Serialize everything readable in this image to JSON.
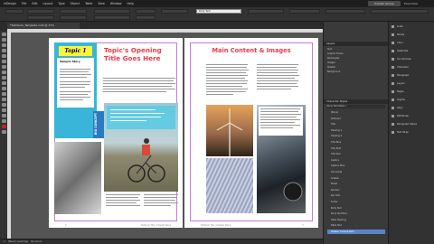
{
  "menu": {
    "app": "InDesign",
    "items": [
      "File",
      "Edit",
      "Layout",
      "Type",
      "Object",
      "Table",
      "View",
      "Window",
      "Help"
    ],
    "publish_label": "Publish Online",
    "workspace_label": "Essentials"
  },
  "control": {
    "paragraph_style": "Body Text"
  },
  "document": {
    "tab_label": "*Textbook_Template.indd @ 37%"
  },
  "left_page": {
    "topic_label": "Topic 1",
    "sidebar_heading": "Sample Story",
    "title": "Topic's Opening Title Goes Here",
    "vertical_label": "BIG CONCEPT",
    "footer": "Textbook Title | Chapter Name",
    "page_number": "2"
  },
  "right_page": {
    "title": "Main Content & Images",
    "footer": "Textbook Title | Chapter Name",
    "page_number": "3"
  },
  "status": {
    "page_field": "2",
    "style_label": "[Basic] (working)",
    "errors": "No errors"
  },
  "layers_panel": {
    "title": "Layers",
    "rows": [
      "Text",
      "Graphic Frame",
      "Rectangles",
      "Images",
      "Sidebar",
      "Background"
    ]
  },
  "char_styles_panel": {
    "title": "Character Styles",
    "current": "Body Text (Basic)",
    "rows": [
      "[None]",
      "Subhead",
      "Title",
      "Heading 1",
      "Heading 2",
      "Title Blue",
      "Title Bold",
      "Title Red",
      "Caption",
      "Caption Blue",
      "Pull Quote",
      "Sidebar",
      "Bullet",
      "Number",
      "Box Text",
      "Footer",
      "Body Text",
      "Body Text Bold",
      "Table Heading",
      "Table Text",
      "Sidebar Content Bold"
    ],
    "selected_index": 20
  },
  "dock": {
    "items": [
      "Links",
      "Stroke",
      "Color",
      "Swatches",
      "CC Libraries",
      "Character",
      "Paragraph",
      "Layers",
      "Pages",
      "Glyphs",
      "Align",
      "Pathfinder",
      "Paragraph Styles",
      "Text Wrap"
    ]
  }
}
